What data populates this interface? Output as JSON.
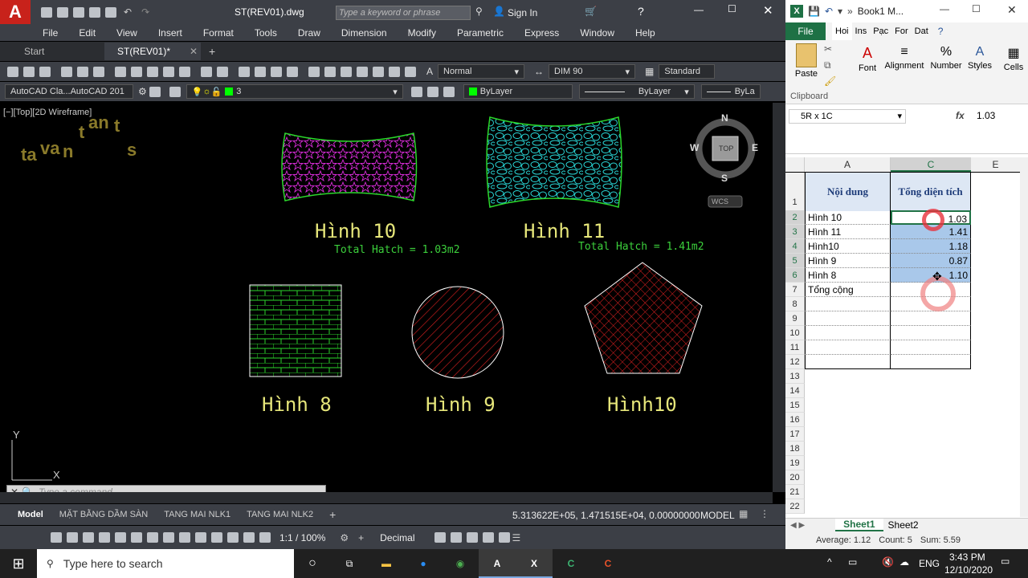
{
  "acad": {
    "file_title": "ST(REV01).dwg",
    "search_placeholder": "Type a keyword or phrase",
    "sign_in": "Sign In",
    "menu": [
      "File",
      "Edit",
      "View",
      "Insert",
      "Format",
      "Tools",
      "Draw",
      "Dimension",
      "Modify",
      "Parametric",
      "Express",
      "Window",
      "Help"
    ],
    "doc_tabs": [
      "Start",
      "ST(REV01)*"
    ],
    "text_style": "Normal",
    "dim_style": "DIM 90",
    "table_style": "Standard",
    "workspace": "AutoCAD Cla...AutoCAD 201",
    "layer": "3",
    "color": "ByLayer",
    "linetype": "ByLayer",
    "lineweight": "ByLa",
    "viewport_label": "[−][Top][2D Wireframe]",
    "viewcube": {
      "n": "N",
      "s": "S",
      "e": "E",
      "w": "W",
      "top": "TOP",
      "wcs": "WCS"
    },
    "logo_text": [
      "ta",
      "va",
      "n",
      "t",
      "an",
      "t",
      "s"
    ],
    "shapes": {
      "h10": {
        "label": "Hình 10",
        "hatch": "Total Hatch = 1.03m2"
      },
      "h11": {
        "label": "Hình 11",
        "hatch": "Total Hatch = 1.41m2"
      },
      "h8": {
        "label": "Hình 8"
      },
      "h9": {
        "label": "Hình 9"
      },
      "h10b": {
        "label": "Hình10"
      }
    },
    "ucs_y": "Y",
    "ucs_x": "X",
    "command_placeholder": "Type a command",
    "layout_tabs": [
      "Model",
      "MẶT BẰNG DẦM SÀN",
      "TANG MAI NLK1",
      "TANG MAI NLK2"
    ],
    "coords": "5.313622E+05, 1.471515E+04, 0.00000000",
    "model_btn": "MODEL",
    "scale": "1:1 / 100%",
    "units": "Decimal"
  },
  "excel": {
    "title": "Book1 M...",
    "ribbon_tabs": [
      "File",
      "Hoi",
      "Ins",
      "Pạc",
      "For",
      "Dat"
    ],
    "groups": [
      "Paste",
      "Font",
      "Alignment",
      "Number",
      "Styles",
      "Cells"
    ],
    "clipboard": "Clipboard",
    "name_box": "5R x 1C",
    "fx": "fx",
    "formula": "1.03",
    "columns": [
      "A",
      "C",
      "E"
    ],
    "header_a": "Nội dung",
    "header_c": "Tổng diện tích",
    "rows": [
      {
        "n": "1",
        "a": "",
        "c": ""
      },
      {
        "n": "2",
        "a": "Hình 10",
        "c": "1.03"
      },
      {
        "n": "3",
        "a": "Hình 11",
        "c": "1.41"
      },
      {
        "n": "4",
        "a": "Hình10",
        "c": "1.18"
      },
      {
        "n": "5",
        "a": "Hình 9",
        "c": "0.87"
      },
      {
        "n": "6",
        "a": "Hình 8",
        "c": "1.10"
      },
      {
        "n": "7",
        "a": "Tổng cộng",
        "c": ""
      },
      {
        "n": "8",
        "a": "",
        "c": ""
      },
      {
        "n": "9",
        "a": "",
        "c": ""
      },
      {
        "n": "10",
        "a": "",
        "c": ""
      },
      {
        "n": "11",
        "a": "",
        "c": ""
      },
      {
        "n": "12",
        "a": "",
        "c": ""
      },
      {
        "n": "13",
        "a": "",
        "c": ""
      },
      {
        "n": "14",
        "a": "",
        "c": ""
      },
      {
        "n": "15",
        "a": "",
        "c": ""
      },
      {
        "n": "16",
        "a": "",
        "c": ""
      },
      {
        "n": "17",
        "a": "",
        "c": ""
      },
      {
        "n": "18",
        "a": "",
        "c": ""
      },
      {
        "n": "19",
        "a": "",
        "c": ""
      },
      {
        "n": "20",
        "a": "",
        "c": ""
      },
      {
        "n": "21",
        "a": "",
        "c": ""
      },
      {
        "n": "22",
        "a": "",
        "c": ""
      }
    ],
    "sheets": [
      "Sheet1",
      "Sheet2"
    ],
    "status": {
      "average": "Average: 1.12",
      "count": "Count: 5",
      "sum": "Sum: 5.59"
    }
  },
  "taskbar": {
    "search_placeholder": "Type here to search",
    "lang": "ENG",
    "time": "3:43 PM",
    "date": "12/10/2020"
  },
  "colors": {
    "acad_red": "#c8221b",
    "excel_green": "#1e7145",
    "hatch_magenta": "#d62bd6",
    "hatch_cyan": "#29d6d6",
    "hatch_green": "#2bd62b",
    "hatch_red": "#e02020",
    "text_yellow": "#e6e67a",
    "text_green": "#3cd03c"
  }
}
